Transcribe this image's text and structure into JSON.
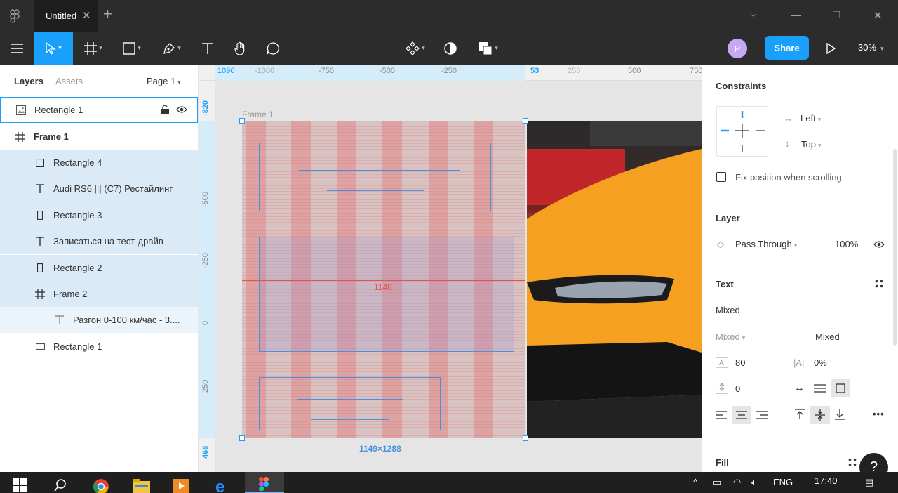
{
  "tabs": {
    "active_title": "Untitled"
  },
  "toolbar": {
    "avatar_initial": "P",
    "share_label": "Share",
    "zoom": "30%"
  },
  "layers_panel": {
    "tab_layers": "Layers",
    "tab_assets": "Assets",
    "page": "Page 1",
    "items": [
      {
        "name": "Rectangle 1",
        "icon": "image-icon",
        "indent": 0
      },
      {
        "name": "Frame 1",
        "icon": "frame-icon",
        "indent": 0
      },
      {
        "name": "Rectangle 4",
        "icon": "rectangle-icon",
        "indent": 1
      },
      {
        "name": "Audi RS6 ||| (C7) Рестайлинг",
        "icon": "text-icon",
        "indent": 1
      },
      {
        "name": "Rectangle 3",
        "icon": "rectangle-icon",
        "indent": 1
      },
      {
        "name": "Записаться на тест-драйв",
        "icon": "text-icon",
        "indent": 1
      },
      {
        "name": "Rectangle 2",
        "icon": "rectangle-icon",
        "indent": 1
      },
      {
        "name": "Frame 2",
        "icon": "frame-icon",
        "indent": 1
      },
      {
        "name": "Разгон 0-100 км/час - 3....",
        "icon": "text-icon",
        "indent": 2
      },
      {
        "name": "Rectangle 1",
        "icon": "rectangle-icon",
        "indent": 1
      }
    ]
  },
  "canvas": {
    "ruler_h": {
      "left_value": "1096",
      "ticks": [
        "-1000",
        "-750",
        "-500",
        "-250",
        "53",
        "250",
        "500",
        "750"
      ]
    },
    "ruler_v": {
      "top_value": "-820",
      "ticks": [
        "-500",
        "-250",
        "0",
        "250"
      ],
      "bottom_value": "468"
    },
    "frame_label": "Frame 1",
    "center_label": "1148",
    "dimension_label": "1149×1288"
  },
  "properties": {
    "constraints_title": "Constraints",
    "horizontal": "Left",
    "vertical": "Top",
    "fix_position": "Fix position when scrolling",
    "layer_title": "Layer",
    "blend_mode": "Pass Through",
    "opacity": "100%",
    "text_title": "Text",
    "font_family": "Mixed",
    "font_weight": "Mixed",
    "font_size": "Mixed",
    "line_height": "80",
    "letter_spacing": "0%",
    "paragraph_spacing": "0",
    "fill_title": "Fill"
  },
  "taskbar": {
    "language": "ENG",
    "time": "17:40"
  },
  "colors": {
    "accent": "#18a0fb",
    "toolbar_bg": "#2c2c2c",
    "selection_bg": "#daebf7"
  }
}
